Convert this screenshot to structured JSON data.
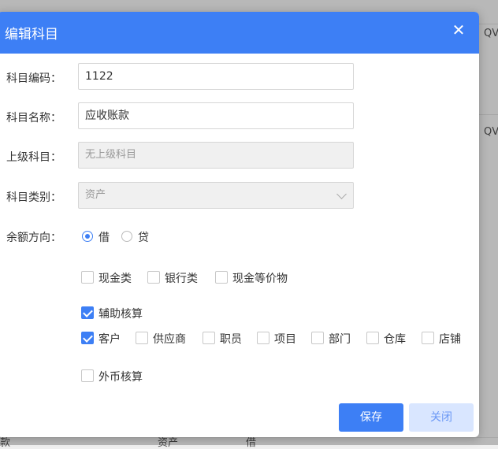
{
  "background": {
    "peek_right_1": "QV",
    "peek_right_2": "QV",
    "bottom_cells": [
      "款",
      "资产",
      "借"
    ]
  },
  "dialog": {
    "title": "编辑科目",
    "close_icon": "close-icon",
    "fields": {
      "code_label": "科目编码：",
      "code_value": "1122",
      "name_label": "科目名称：",
      "name_value": "应收账款",
      "parent_label": "上级科目：",
      "parent_value": "无上级科目",
      "type_label": "科目类别：",
      "type_value": "资产"
    },
    "direction": {
      "label": "余额方向：",
      "options": [
        "借",
        "贷"
      ],
      "selected": "借"
    },
    "cash_options": [
      {
        "label": "现金类",
        "checked": false
      },
      {
        "label": "银行类",
        "checked": false
      },
      {
        "label": "现金等价物",
        "checked": false
      }
    ],
    "aux": {
      "label": "辅助核算",
      "checked": true
    },
    "aux_items": [
      {
        "label": "客户",
        "checked": true
      },
      {
        "label": "供应商",
        "checked": false
      },
      {
        "label": "职员",
        "checked": false
      },
      {
        "label": "项目",
        "checked": false
      },
      {
        "label": "部门",
        "checked": false
      },
      {
        "label": "仓库",
        "checked": false
      },
      {
        "label": "店铺",
        "checked": false
      }
    ],
    "foreign": {
      "label": "外币核算",
      "checked": false
    },
    "buttons": {
      "save": "保存",
      "close": "关闭"
    }
  },
  "colors": {
    "accent": "#3d7ff5",
    "header_bg": "#3d7ff5"
  }
}
